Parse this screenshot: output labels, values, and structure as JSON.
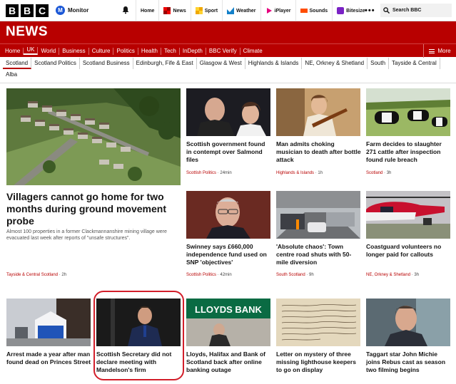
{
  "brand": {
    "letters": [
      "B",
      "B",
      "C"
    ],
    "monitor": "Monitor",
    "monitor_initial": "M"
  },
  "topnav": {
    "items": [
      {
        "label": "Home",
        "icon": "home-icon"
      },
      {
        "label": "News",
        "icon": "news-icon"
      },
      {
        "label": "Sport",
        "icon": "sport-icon"
      },
      {
        "label": "Weather",
        "icon": "weather-icon"
      },
      {
        "label": "iPlayer",
        "icon": "iplayer-icon"
      },
      {
        "label": "Sounds",
        "icon": "sounds-icon"
      },
      {
        "label": "Bitesize",
        "icon": "bitesize-icon"
      }
    ],
    "more_dots": "•••",
    "search_placeholder": "Search BBC"
  },
  "news_title": "NEWS",
  "sections": [
    "Home",
    "UK",
    "World",
    "Business",
    "Culture",
    "Politics",
    "Health",
    "Tech",
    "InDepth",
    "BBC Verify",
    "Climate"
  ],
  "sections_more": "More",
  "regions": [
    "Scotland",
    "Scotland Politics",
    "Scotland Business",
    "Edinburgh, Fife & East",
    "Glasgow & West",
    "Highlands & Islands",
    "NE, Orkney & Shetland",
    "South",
    "Tayside & Central",
    "Alba"
  ],
  "colors": {
    "brand_red": "#b80000",
    "highlight": "#d21e2a"
  },
  "stories": {
    "lead": {
      "headline": "Villagers cannot go home for two months during ground movement probe",
      "summary": "Almost 100 properties in a former Clackmannanshire mining village were evacuated last week after reports of \"unsafe structures\".",
      "section": "Tayside & Central Scotland",
      "time": "2h"
    },
    "s1": {
      "headline": "Scottish government found in contempt over Salmond files",
      "section": "Scottish Politics",
      "time": "24min"
    },
    "s2": {
      "headline": "Man admits choking musician to death after bottle attack",
      "section": "Highlands & Islands",
      "time": "1h"
    },
    "s3": {
      "headline": "Farm decides to slaughter 271 cattle after inspection found rule breach",
      "section": "Scotland",
      "time": "3h"
    },
    "s4": {
      "headline": "Swinney says £660,000 independence fund used on SNP 'objectives'",
      "section": "Scottish Politics",
      "time": "42min"
    },
    "s5": {
      "headline": "'Absolute chaos': Town centre road shuts with 50-mile diversion",
      "section": "South Scotland",
      "time": "9h"
    },
    "s6": {
      "headline": "Coastguard volunteers no longer paid for callouts",
      "section": "NE, Orkney & Shetland",
      "time": "3h"
    },
    "b1": {
      "headline": "Arrest made a year after man found dead on Princes Street"
    },
    "b2": {
      "headline": "Scottish Secretary did not declare meeting with Mandelson's firm"
    },
    "b3": {
      "headline": "Lloyds, Halifax and Bank of Scotland back after online banking outage",
      "sign_text": "LLOYDS BANK"
    },
    "b4": {
      "headline": "Letter on mystery of three missing lighthouse keepers to go on display"
    },
    "b5": {
      "headline": "Taggart star John Michie joins Rebus cast as season two filming begins"
    }
  }
}
